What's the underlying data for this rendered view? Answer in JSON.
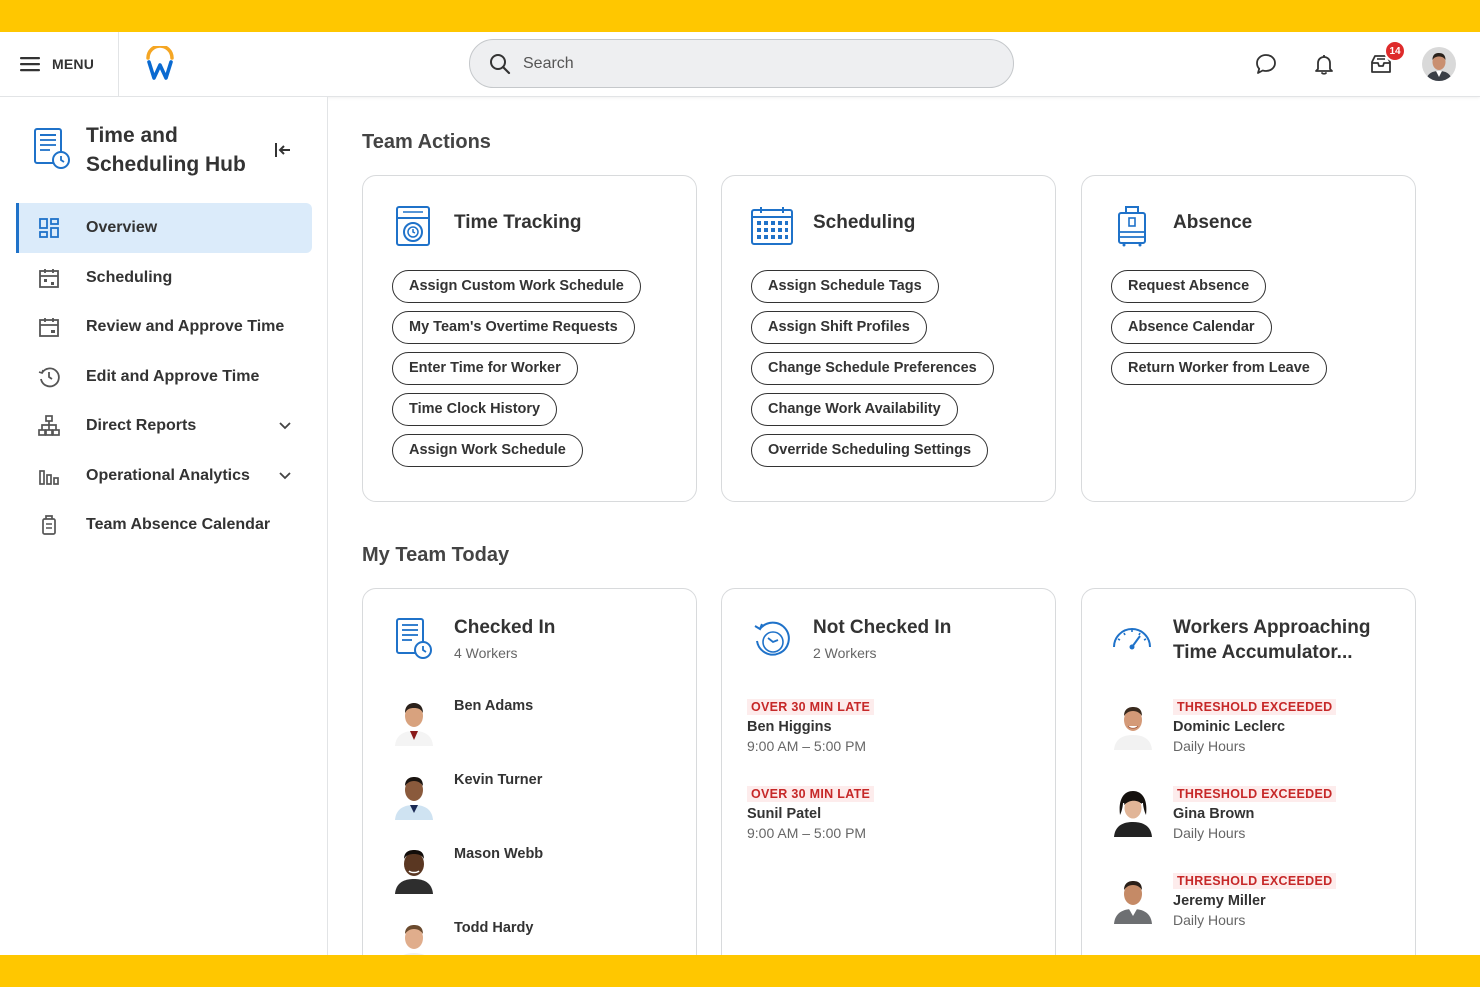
{
  "topbar": {
    "menu_label": "MENU",
    "search_placeholder": "Search",
    "inbox_badge": "14"
  },
  "sidebar": {
    "title": "Time and Scheduling Hub",
    "items": [
      {
        "label": "Overview",
        "icon": "grid-icon"
      },
      {
        "label": "Scheduling",
        "icon": "calendar-icon"
      },
      {
        "label": "Review and Approve Time",
        "icon": "calendar-check-icon"
      },
      {
        "label": "Edit and Approve Time",
        "icon": "clock-icon"
      },
      {
        "label": "Direct Reports",
        "icon": "org-chart-icon"
      },
      {
        "label": "Operational Analytics",
        "icon": "bar-chart-icon"
      },
      {
        "label": "Team Absence Calendar",
        "icon": "luggage-icon"
      }
    ]
  },
  "team_actions": {
    "title": "Team Actions",
    "cards": [
      {
        "title": "Time Tracking",
        "actions": [
          "Assign Custom Work Schedule",
          "My Team's Overtime Requests",
          "Enter Time for Worker",
          "Time Clock History",
          "Assign Work Schedule"
        ]
      },
      {
        "title": "Scheduling",
        "actions": [
          "Assign Schedule Tags",
          "Assign Shift Profiles",
          "Change Schedule Preferences",
          "Change Work Availability",
          "Override Scheduling Settings"
        ]
      },
      {
        "title": "Absence",
        "actions": [
          "Request Absence",
          "Absence Calendar",
          "Return Worker from Leave"
        ]
      }
    ]
  },
  "my_team_today": {
    "title": "My Team Today",
    "checked_in": {
      "title": "Checked In",
      "subtitle": "4 Workers",
      "people": [
        "Ben Adams",
        "Kevin Turner",
        "Mason Webb",
        "Todd Hardy"
      ]
    },
    "not_checked_in": {
      "title": "Not Checked In",
      "subtitle": "2 Workers",
      "people": [
        {
          "tag": "OVER 30 MIN LATE",
          "name": "Ben Higgins",
          "time": "9:00 AM – 5:00 PM"
        },
        {
          "tag": "OVER 30 MIN LATE",
          "name": "Sunil Patel",
          "time": "9:00 AM – 5:00 PM"
        }
      ]
    },
    "accumulator": {
      "title": "Workers Approaching Time Accumulator...",
      "people": [
        {
          "tag": "THRESHOLD EXCEEDED",
          "name": "Dominic Leclerc",
          "detail": "Daily Hours"
        },
        {
          "tag": "THRESHOLD EXCEEDED",
          "name": "Gina Brown",
          "detail": "Daily Hours"
        },
        {
          "tag": "THRESHOLD EXCEEDED",
          "name": "Jeremy Miller",
          "detail": "Daily Hours"
        }
      ]
    }
  },
  "colors": {
    "brand_yellow": "#ffc700",
    "accent_blue": "#1f72c9",
    "alert_red": "#c62828"
  }
}
